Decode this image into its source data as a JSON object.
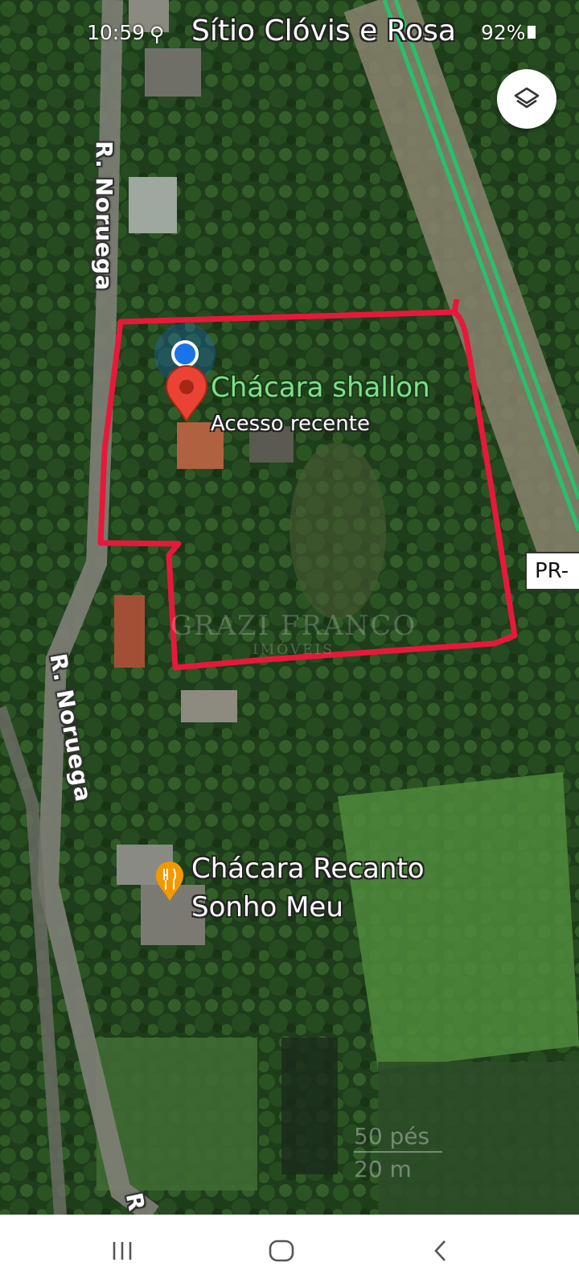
{
  "status_bar": {
    "time": "10:59",
    "battery": "92%"
  },
  "place_title": "Sítio Clóvis e Rosa",
  "streets": [
    {
      "id": "r-noruega-top",
      "label": "R. Noruega"
    },
    {
      "id": "r-noruega-mid",
      "label": "R. Noruega"
    },
    {
      "id": "r-noruega-bottom",
      "label": "R"
    }
  ],
  "route_shield": {
    "label": "PR-"
  },
  "selected_place": {
    "name": "Chácara shallon",
    "subtitle": "Acesso recente",
    "name_color": "#7ee08a",
    "pin_color": "#ea4335"
  },
  "poi": {
    "line1": "Chácara Recanto",
    "line2": "Sonho Meu",
    "icon": "restaurant-icon",
    "color": "#f29900"
  },
  "watermark": {
    "main": "GRAZI FRANCO",
    "sub": "IMÓVEIS"
  },
  "scale": {
    "top": "50 pés",
    "bottom": "20 m"
  },
  "colors": {
    "boundary": "#e8183a",
    "highway": "#27c16b",
    "location_dot": "#1a73e8"
  }
}
